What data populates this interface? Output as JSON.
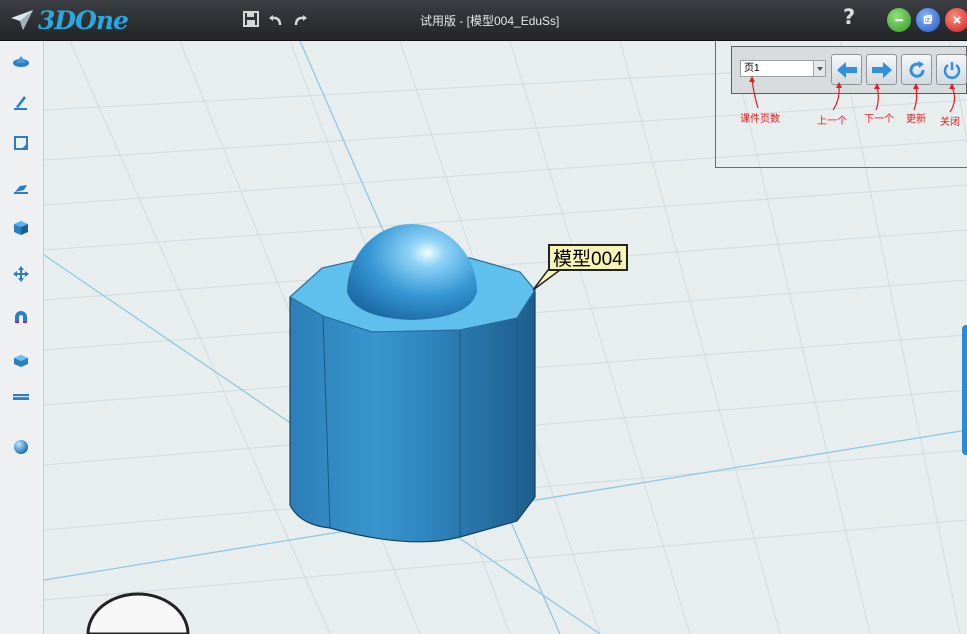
{
  "app": {
    "logo": "3DOne",
    "window_title": "试用版 - [模型004_EduSs]",
    "help_label": "?"
  },
  "toolbar_icons": [
    "save-icon",
    "undo-icon",
    "redo-icon"
  ],
  "window_buttons": [
    {
      "name": "minimize",
      "color": "#4caf3a"
    },
    {
      "name": "maximize",
      "color": "#2f6fd6"
    },
    {
      "name": "close",
      "color": "#e0342a"
    }
  ],
  "sidebar": {
    "items": [
      {
        "name": "basic-shapes"
      },
      {
        "name": "sketch"
      },
      {
        "name": "sketch-edit"
      },
      {
        "name": "special-features"
      },
      {
        "name": "feature-modify"
      },
      {
        "name": "basic-edit"
      },
      {
        "name": "combine"
      },
      {
        "name": "face-tools"
      },
      {
        "name": "measure"
      },
      {
        "name": "materials"
      }
    ]
  },
  "page_panel": {
    "page_select_value": "页1",
    "annotations": {
      "page_count": "课件页数",
      "prev": "上一个",
      "next": "下一个",
      "refresh": "更新",
      "close": "关闭"
    }
  },
  "viewport": {
    "model_label": "模型004",
    "model_color": "#3a9fd8"
  }
}
